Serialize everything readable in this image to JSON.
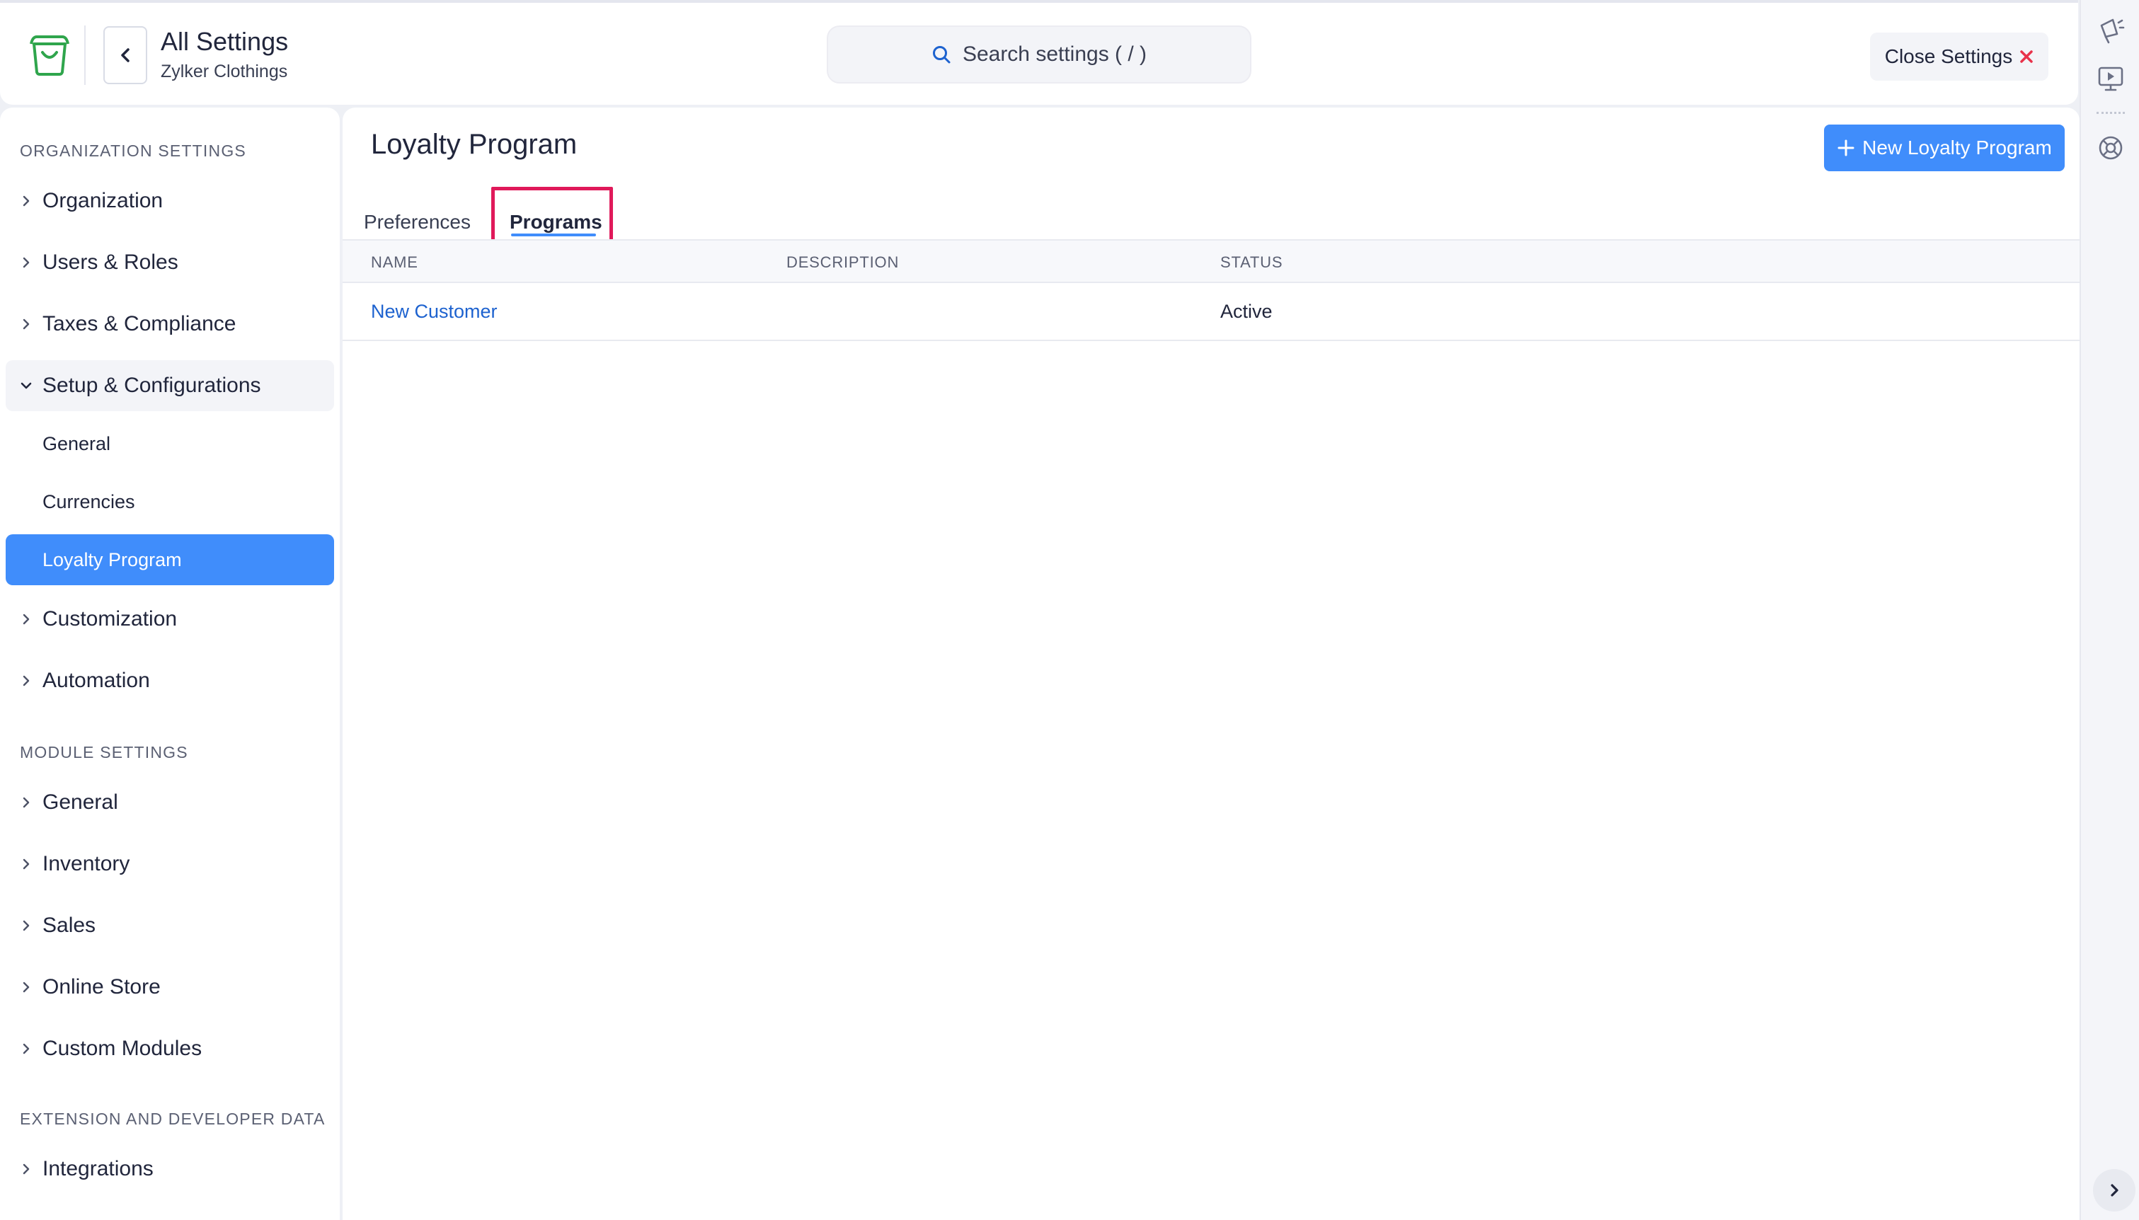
{
  "header": {
    "title": "All Settings",
    "subtitle": "Zylker Clothings",
    "search_placeholder": "Search settings ( / )",
    "close_label": "Close Settings"
  },
  "sidebar": {
    "org_section": "ORGANIZATION SETTINGS",
    "org_items": [
      {
        "label": "Organization"
      },
      {
        "label": "Users & Roles"
      },
      {
        "label": "Taxes & Compliance"
      },
      {
        "label": "Setup & Configurations"
      }
    ],
    "setup_sub_items": [
      {
        "label": "General"
      },
      {
        "label": "Currencies"
      },
      {
        "label": "Loyalty Program"
      }
    ],
    "org_items_after": [
      {
        "label": "Customization"
      },
      {
        "label": "Automation"
      }
    ],
    "module_section": "MODULE SETTINGS",
    "module_items": [
      {
        "label": "General"
      },
      {
        "label": "Inventory"
      },
      {
        "label": "Sales"
      },
      {
        "label": "Online Store"
      },
      {
        "label": "Custom Modules"
      }
    ],
    "ext_section": "EXTENSION AND DEVELOPER DATA",
    "ext_items": [
      {
        "label": "Integrations"
      }
    ]
  },
  "main": {
    "title": "Loyalty Program",
    "new_button": "New Loyalty Program",
    "tabs": [
      {
        "label": "Preferences"
      },
      {
        "label": "Programs"
      }
    ],
    "table": {
      "columns": [
        "NAME",
        "DESCRIPTION",
        "STATUS"
      ],
      "rows": [
        {
          "name": "New Customer",
          "description": "",
          "status": "Active"
        }
      ]
    }
  },
  "colors": {
    "accent": "#408dfb",
    "highlight": "#e0195a",
    "link": "#1d62cf",
    "brand_green": "#2fa54c",
    "close_x": "#e8324a"
  }
}
